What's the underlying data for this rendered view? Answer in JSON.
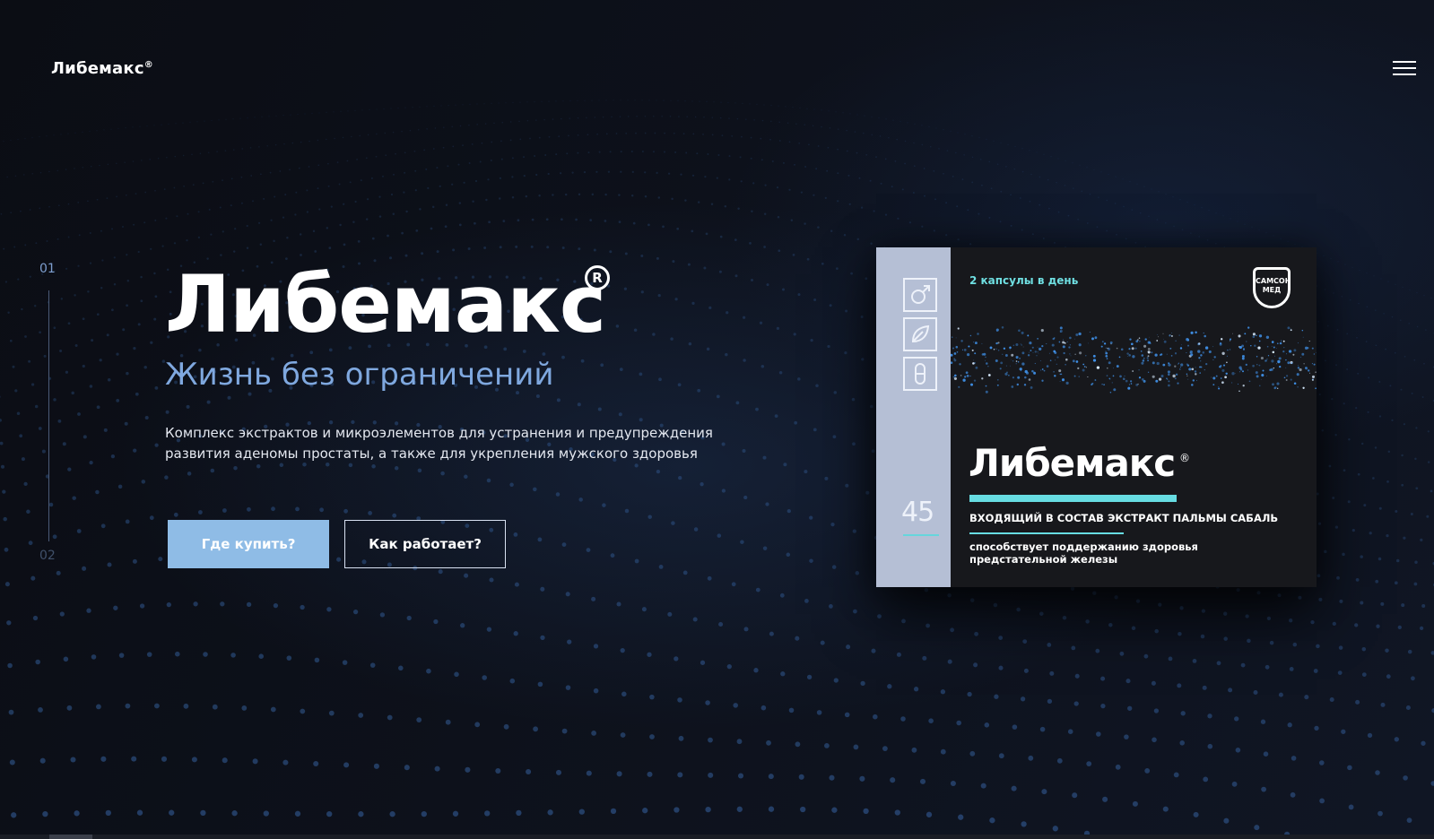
{
  "header": {
    "logo_text": "Либемакс",
    "logo_reg": "®",
    "menu_icon": "hamburger-icon"
  },
  "pager": {
    "current": "01",
    "next": "02"
  },
  "hero": {
    "title": "Либемакс",
    "title_reg": "R",
    "subtitle": "Жизнь без ограничений",
    "description": "Комплекс экстрактов и микроэлементов для устранения и предупреждения развития аденомы простаты, а также для укрепления мужского здоровья",
    "buy_button": "Где купить?",
    "how_button": "Как работает?"
  },
  "product": {
    "dosage": "2 капсулы в день",
    "brand_badge": "САМСОН МЕД",
    "count": "45",
    "name": "Либемакс",
    "name_reg": "®",
    "ingredient": "ВХОДЯЩИЙ В СОСТАВ ЭКСТРАКТ ПАЛЬМЫ САБАЛЬ",
    "note": "способствует поддержанию здоровья предстательной железы",
    "icons": [
      "male-symbol-icon",
      "leaf-icon",
      "capsule-icon"
    ]
  },
  "colors": {
    "accent": "#8fbce6",
    "subtitle": "#7fa8df",
    "cyan": "#67dce2",
    "background": "#0c0f17"
  }
}
